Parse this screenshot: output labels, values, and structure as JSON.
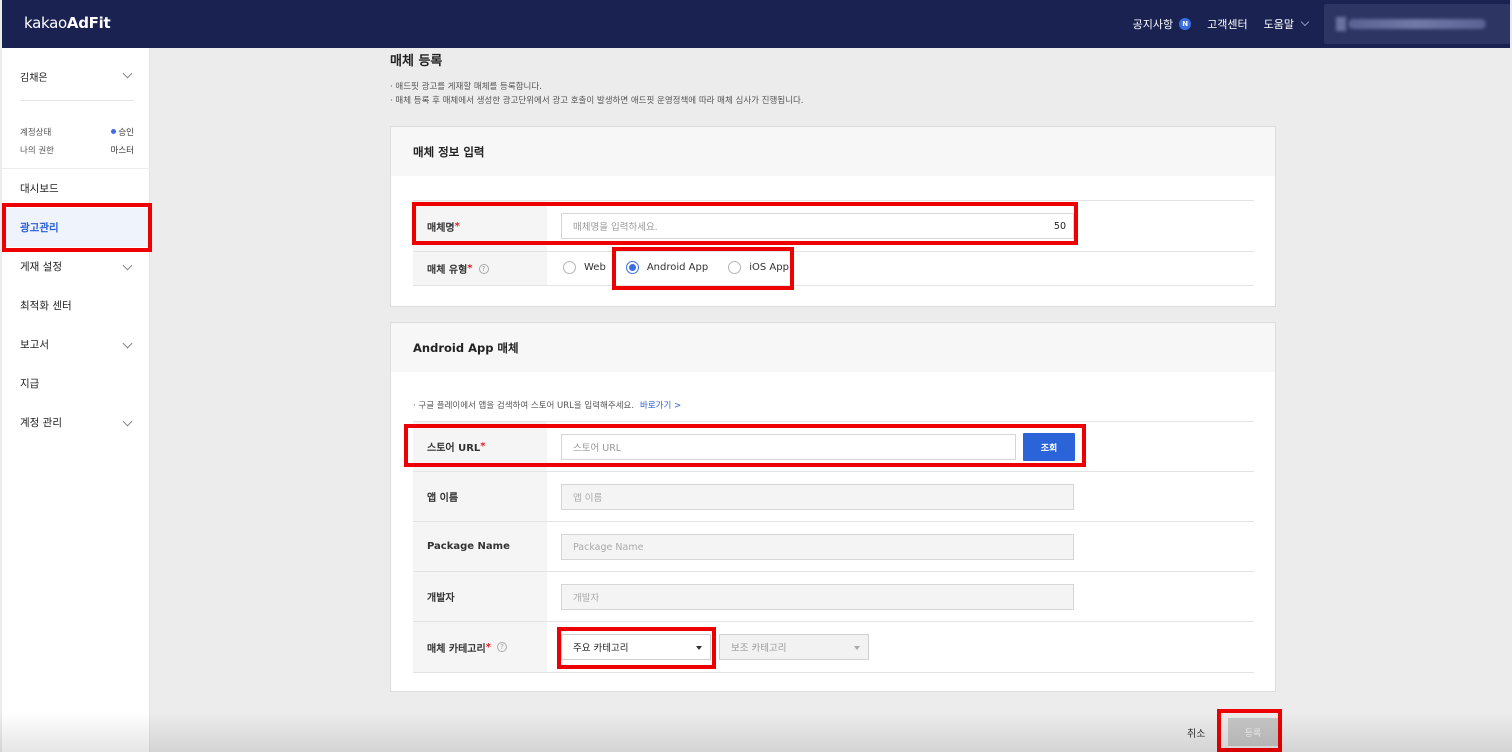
{
  "topbar": {
    "logo_light": "kakao",
    "logo_bold": "AdFit",
    "notice": "공지사항",
    "notice_badge": "N",
    "support": "고객센터",
    "help": "도움말"
  },
  "sidebar": {
    "user_name": "김채은",
    "account_status_label": "계정상태",
    "account_status_value": "승인",
    "my_role_label": "나의 권한",
    "my_role_value": "마스터",
    "items": [
      {
        "label": "대시보드"
      },
      {
        "label": "광고관리"
      },
      {
        "label": "게재 설정"
      },
      {
        "label": "최적화 센터"
      },
      {
        "label": "보고서"
      },
      {
        "label": "지급"
      },
      {
        "label": "계정 관리"
      }
    ]
  },
  "page": {
    "title": "매체 등록",
    "desc1": "· 애드핏 광고를 게재할 매체를 등록합니다.",
    "desc2": "· 매체 등록 후 매체에서 생성한 광고단위에서 광고 호출이 발생하면 애드핏 운영정책에 따라 매체 심사가 진행됩니다."
  },
  "info_card": {
    "title": "매체 정보 입력",
    "name_label": "매체명",
    "name_placeholder": "매체명을 입력하세요.",
    "name_counter": "50",
    "type_label": "매체 유형",
    "type_options": [
      "Web",
      "Android App",
      "iOS App"
    ],
    "type_selected": "Android App"
  },
  "app_card": {
    "title": "Android App 매체",
    "note": "· 구글 플레이에서 앱을 검색하여 스토어 URL을 입력해주세요.",
    "note_link": "바로가기 >",
    "store_url_label": "스토어 URL",
    "store_url_placeholder": "스토어 URL",
    "lookup_button": "조회",
    "app_name_label": "앱 이름",
    "app_name_placeholder": "앱 이름",
    "package_label": "Package Name",
    "package_placeholder": "Package Name",
    "developer_label": "개발자",
    "developer_placeholder": "개발자",
    "category_label": "매체 카테고리",
    "primary_category": "주요 카테고리",
    "secondary_category": "보조 카테고리"
  },
  "footer": {
    "cancel": "취소",
    "submit": "등록"
  },
  "colors": {
    "topbar": "#1a2252",
    "accent": "#2a64d8",
    "highlight": "#ee0000",
    "required": "#e0202a"
  }
}
